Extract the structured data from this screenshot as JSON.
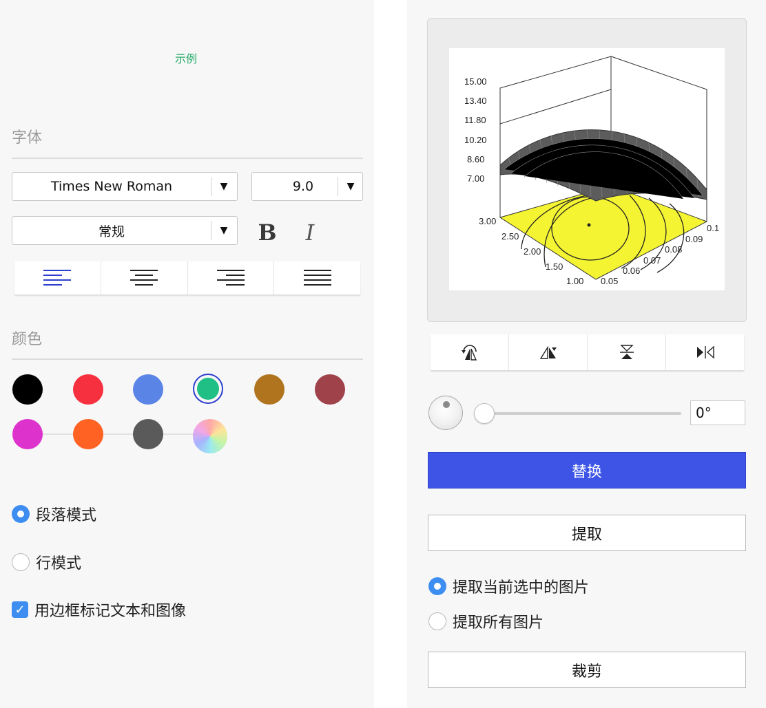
{
  "left": {
    "sample_label": "示例",
    "font_section": {
      "title": "字体",
      "font_family": "Times New Roman",
      "font_size": "9.0",
      "font_style": "常规",
      "bold_label": "B",
      "italic_label": "I",
      "dropdown_arrow": "▼",
      "alignment_options": [
        "align-left",
        "align-center",
        "align-right",
        "align-justify"
      ],
      "alignment_selected": "align-left"
    },
    "color_section": {
      "title": "颜色",
      "swatches": [
        "#000000",
        "#f73040",
        "#5a84e6",
        "#1fbf86",
        "#b0741e",
        "#a0424a",
        "#dd33cc",
        "#ff6222",
        "#5a5a5a",
        "color-wheel"
      ],
      "selected": "#1fbf86"
    },
    "mode": {
      "paragraph_label": "段落模式",
      "line_label": "行模式",
      "selected": "段落模式",
      "border_label": "用边框标记文本和图像",
      "border_checked": true
    }
  },
  "right": {
    "image_preview": {
      "z_ticks": [
        "15.00",
        "13.40",
        "11.80",
        "10.20",
        "8.60",
        "7.00"
      ],
      "y_ticks": [
        "3.00",
        "2.50",
        "2.00",
        "1.50",
        "1.00"
      ],
      "x_ticks": [
        "0.05",
        "0.06",
        "0.07",
        "0.08",
        "0.09",
        "0.1"
      ],
      "surface_color": "#555555",
      "contour_fill": "#f4f433"
    },
    "transform_icons": [
      "rotate-icon",
      "flip-rotate-icon",
      "flip-vertical-icon",
      "flip-horizontal-icon"
    ],
    "rotation": {
      "angle_value": "0°",
      "slider_fraction": 0
    },
    "replace_button": "替换",
    "extract_button": "提取",
    "extract_options": {
      "current_label": "提取当前选中的图片",
      "all_label": "提取所有图片",
      "selected": "提取当前选中的图片"
    },
    "crop_button": "裁剪"
  }
}
